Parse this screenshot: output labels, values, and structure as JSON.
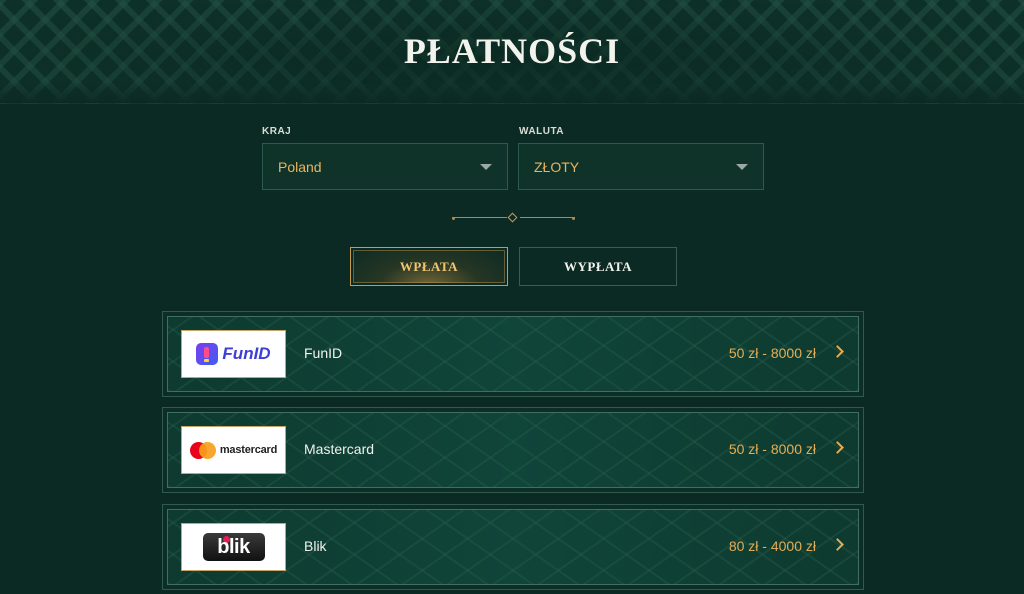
{
  "page": {
    "title": "PŁATNOŚCI"
  },
  "filters": {
    "country": {
      "label": "KRAJ",
      "value": "Poland"
    },
    "currency": {
      "label": "WALUTA",
      "value": "ZŁOTY"
    }
  },
  "tabs": [
    {
      "label": "WPŁATA",
      "active": true
    },
    {
      "label": "WYPŁATA",
      "active": false
    }
  ],
  "methods": [
    {
      "name": "FunID",
      "range": "50 zł - 8000 zł",
      "logo_text": "FunID",
      "icon": "funid-logo"
    },
    {
      "name": "Mastercard",
      "range": "50 zł - 8000 zł",
      "logo_text": "mastercard",
      "icon": "mastercard-logo"
    },
    {
      "name": "Blik",
      "range": "80 zł - 4000 zł",
      "logo_text": "blik",
      "icon": "blik-logo"
    }
  ],
  "colors": {
    "background": "#0b2a23",
    "accent_gold": "#e4ad55",
    "border_green": "#3f6f60"
  }
}
